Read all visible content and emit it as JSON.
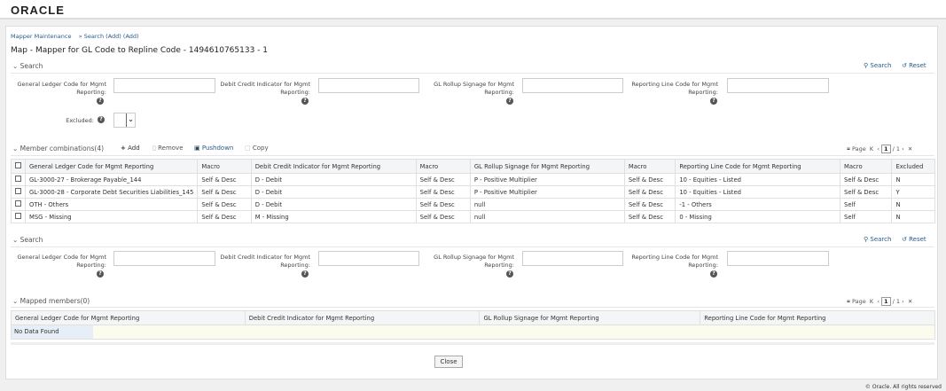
{
  "brand": "ORACLE",
  "breadcrumb": [
    "Mapper Maintenance",
    "» Search",
    "(Add)",
    "(Add)"
  ],
  "title": "Map - Mapper for GL Code to Repline Code - 1494610765133 - 1",
  "search1": {
    "label": "Search",
    "search": "Search",
    "reset": "Reset",
    "fields": [
      "General Ledger Code for Mgmt Reporting:",
      "Debit Credit Indicator for Mgmt Reporting:",
      "GL Rollup Signage for Mgmt Reporting:",
      "Reporting Line Code for Mgmt Reporting:"
    ],
    "excluded": "Excluded:"
  },
  "members": {
    "label": "Member combinations(4)",
    "add": "Add",
    "remove": "Remove",
    "pushdown": "Pushdown",
    "copy": "Copy",
    "pager": {
      "label": "Page",
      "current": "1",
      "total": "/ 1"
    },
    "columns": [
      "General Ledger Code for Mgmt Reporting",
      "Macro",
      "Debit Credit Indicator for Mgmt Reporting",
      "Macro",
      "GL Rollup Signage for Mgmt Reporting",
      "Macro",
      "Reporting Line Code for Mgmt Reporting",
      "Macro",
      "Excluded"
    ],
    "rows": [
      [
        "GL-3000-27 - Brokerage Payable_144",
        "Self & Desc",
        "D - Debit",
        "Self & Desc",
        "P - Positive Multiplier",
        "Self & Desc",
        "10 - Equities - Listed",
        "Self & Desc",
        "N"
      ],
      [
        "GL-3000-28 - Corporate Debt Securities Liabilities_145",
        "Self & Desc",
        "D - Debit",
        "Self & Desc",
        "P - Positive Multiplier",
        "Self & Desc",
        "10 - Equities - Listed",
        "Self & Desc",
        "Y"
      ],
      [
        "OTH - Others",
        "Self & Desc",
        "D - Debit",
        "Self & Desc",
        "null",
        "Self & Desc",
        "-1 - Others",
        "Self",
        "N"
      ],
      [
        "MSG - Missing",
        "Self & Desc",
        "M - Missing",
        "Self & Desc",
        "null",
        "Self & Desc",
        "0 - Missing",
        "Self",
        "N"
      ]
    ]
  },
  "search2": {
    "label": "Search",
    "search": "Search",
    "reset": "Reset",
    "fields": [
      "General Ledger Code for Mgmt Reporting:",
      "Debit Credit Indicator for Mgmt Reporting:",
      "GL Rollup Signage for Mgmt Reporting:",
      "Reporting Line Code for Mgmt Reporting:"
    ]
  },
  "mapped": {
    "label": "Mapped members(0)",
    "pager": {
      "label": "Page",
      "current": "1",
      "total": "/ 1"
    },
    "columns": [
      "General Ledger Code for Mgmt Reporting",
      "Debit Credit Indicator for Mgmt Reporting",
      "GL Rollup Signage for Mgmt Reporting",
      "Reporting Line Code for Mgmt Reporting"
    ],
    "empty": "No Data Found"
  },
  "close": "Close",
  "footer": "© Oracle. All rights reserved"
}
